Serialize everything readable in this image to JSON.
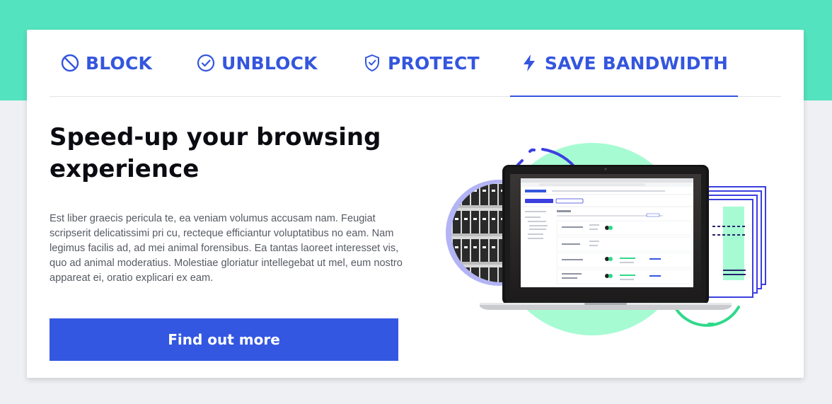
{
  "tabs": [
    {
      "label": "BLOCK",
      "icon": "block-icon",
      "active": false
    },
    {
      "label": "UNBLOCK",
      "icon": "check-circle-icon",
      "active": false
    },
    {
      "label": "PROTECT",
      "icon": "shield-icon",
      "active": false
    },
    {
      "label": "SAVE BANDWIDTH",
      "icon": "lightning-icon",
      "active": true
    }
  ],
  "hero": {
    "title": "Speed-up your browsing experience",
    "body": "Est liber graecis pericula te, ea veniam volumus accusam nam. Feugiat scripserit delicatissimi pri cu, recteque efficiantur voluptatibus no eam. Nam legimus facilis ad, ad mei animal forensibus. Ea tantas laoreet interesset vis, quo ad animal moderatius. Molestiae gloriatur intellegebat ut mel, eum nostro appareat ei, oratio explicari ex eam.",
    "cta_label": "Find out more"
  },
  "colors": {
    "accent": "#3456de",
    "band": "#53e3bf",
    "page_bg": "#eff0f4",
    "mint_circle": "#a6fbd3",
    "lavender": "#b3b4f5",
    "green_arc": "#2fd98a"
  }
}
